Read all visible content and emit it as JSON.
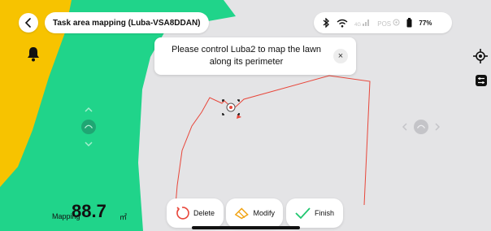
{
  "header": {
    "back_label": "Back",
    "title": "Task area mapping  (Luba-VSA8DDAN)"
  },
  "status": {
    "bluetooth_icon": "bluetooth-icon",
    "wifi_icon": "wifi-icon",
    "cellular_label": "4G",
    "pos_label": "POS",
    "battery_percent": "77%"
  },
  "toast": {
    "message_line1": "Please control Luba2 to map the lawn",
    "message_line2": "along its perimeter",
    "close_label": "×"
  },
  "actions": {
    "delete_label": "Delete",
    "modify_label": "Modify",
    "finish_label": "Finish"
  },
  "mapping": {
    "label": "Mapping",
    "value": "88.7",
    "unit": "㎡"
  },
  "colors": {
    "lawn_green": "#20d48a",
    "lawn_yellow": "#f7c300",
    "map_grey": "#e4e4e6",
    "boundary_red": "#e8463a"
  }
}
